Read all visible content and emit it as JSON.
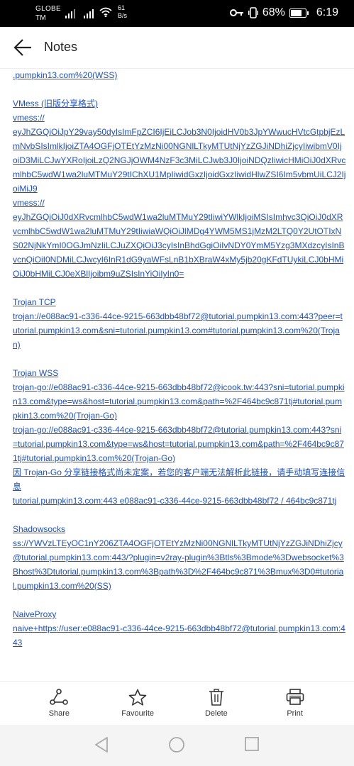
{
  "status_bar": {
    "carrier_line1": "GLOBE",
    "carrier_line2": "TM",
    "speed_value": "61",
    "speed_unit": "B/s",
    "battery": "68%",
    "time": "6:19"
  },
  "app_bar": {
    "title": "Notes",
    "back_icon": "arrow-left-icon"
  },
  "note": {
    "top_fragment": ".pumpkin13.com%20(WSS)",
    "vmess": {
      "title": "VMess (旧版分享格式)",
      "lines": [
        "vmess://",
        "eyJhZGQiOiJpY29vay50dyIsImFpZCI6IjEiLCJob3N0IjoidHV0b3JpYWwucHVtcGtpbjEzLmNvbSIsImlkIjoiZTA4OGFjOTEtYzMzNi00NGNlLTkyMTUtNjYzZGJiNDhiZjcyIiwibmV0IjoiD3MiLCJwYXRoIjoiLzQ2NGJjOWM4NzF3c3MiLCJwb3J0IjoiNDQzIiwicHMiOiJ0dXRvcmlhbC5wdW1wa2luMTMuY29tIChXU1MpIiwidGxzIjoidGxzIiwidHlwZSI6Im5vbmUiLCJ2IjoiMiJ9",
        "vmess://",
        "eyJhZGQiOiJ0dXRvcmlhbC5wdW1wa2luMTMuY29tIiwiYWlkIjoiMSIsImhvc3QiOiJ0dXRvcmlhbC5wdW1wa2luMTMuY29tIiwiaWQiOiJlMDg4YWM5MS1jMzM2LTQ0Y2UtOTIxNS02NjNkYmI0OGJmNzIiLCJuZXQiOiJ3cyIsInBhdGgiOiIvNDY0YmM5Yzg3MXdzcyIsInBvcnQiOiI0NDMiLCJwcyI6InR1dG9yaWFsLnB1bXBraW4xMy5jb20gKFdTUykiLCJ0bHMiOiJ0bHMiLCJ0eXBlIjoibm9uZSIsInYiOiIyIn0="
      ]
    },
    "trojan_tcp": {
      "title": "Trojan TCP",
      "lines": [
        "trojan://e088ac91-c336-44ce-9215-663dbb48bf72@tutorial.pumpkin13.com:443?peer=tutorial.pumpkin13.com&sni=tutorial.pumpkin13.com#tutorial.pumpkin13.com%20(Trojan)"
      ]
    },
    "trojan_wss": {
      "title": "Trojan WSS",
      "lines": [
        "trojan-go://e088ac91-c336-44ce-9215-663dbb48bf72@icook.tw:443?sni=tutorial.pumpkin13.com&type=ws&host=tutorial.pumpkin13.com&path=%2F464bc9c871tj#tutorial.pumpkin13.com%20(Trojan-Go)",
        "trojan-go://e088ac91-c336-44ce-9215-663dbb48bf72@tutorial.pumpkin13.com:443?sni=tutorial.pumpkin13.com&type=ws&host=tutorial.pumpkin13.com&path=%2F464bc9c871tj#tutorial.pumpkin13.com%20(Trojan-Go)",
        "因 Trojan-Go 分享链接格式尚未定案，若您的客户端无法解析此链接，请手动填写连接信息",
        "tutorial.pumpkin13.com:443 e088ac91-c336-44ce-9215-663dbb48bf72 / 464bc9c871tj"
      ]
    },
    "shadowsocks": {
      "title": "Shadowsocks",
      "lines": [
        "ss://YWVzLTEyOC1nY206ZTA4OGFjOTEtYzMzNi00NGNlLTkyMTUtNjYzZGJiNDhiZjcy@tutorial.pumpkin13.com:443/?plugin=v2ray-plugin%3Btls%3Bmode%3Dwebsocket%3Bhost%3Dtutorial.pumpkin13.com%3Bpath%3D%2F464bc9c871%3Bmux%3D0#tutorial.pumpkin13.com%20(SS)"
      ]
    },
    "naiveproxy": {
      "title": "NaiveProxy",
      "lines": [
        "naive+https://user:e088ac91-c336-44ce-9215-663dbb48bf72@tutorial.pumpkin13.com:443"
      ]
    }
  },
  "toolbar": {
    "share_label": "Share",
    "favourite_label": "Favourite",
    "delete_label": "Delete",
    "print_label": "Print"
  },
  "colors": {
    "link": "#1a4fd0",
    "status_bar_bg": "#000000",
    "nav_bar_bg": "#f4f4f4"
  }
}
